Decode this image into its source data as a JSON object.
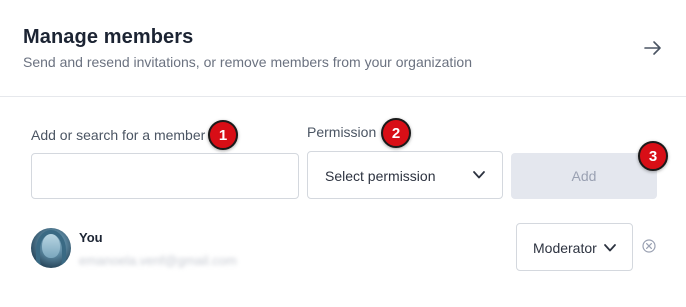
{
  "header": {
    "title": "Manage members",
    "subtitle": "Send and resend invitations, or remove members from your organization"
  },
  "form": {
    "member_label": "Add or search for a member",
    "member_value": "",
    "member_placeholder": "",
    "permission_label": "Permission",
    "permission_value": "Select permission",
    "add_label": "Add"
  },
  "markers": [
    "1",
    "2",
    "3"
  ],
  "members": [
    {
      "name": "You",
      "email": "emanoela.venf@gmail.com",
      "role": "Moderator"
    }
  ],
  "icons": {
    "header_action": "arrow-right-icon",
    "dropdown": "chevron-down-icon",
    "remove": "close-circle-icon"
  },
  "colors": {
    "title": "#1c2433",
    "muted_text": "#6b7280",
    "border": "#d4d8de",
    "disabled_button_bg": "#e4e7ee",
    "disabled_button_text": "#9aa1b2",
    "marker_red": "#d80e16"
  }
}
